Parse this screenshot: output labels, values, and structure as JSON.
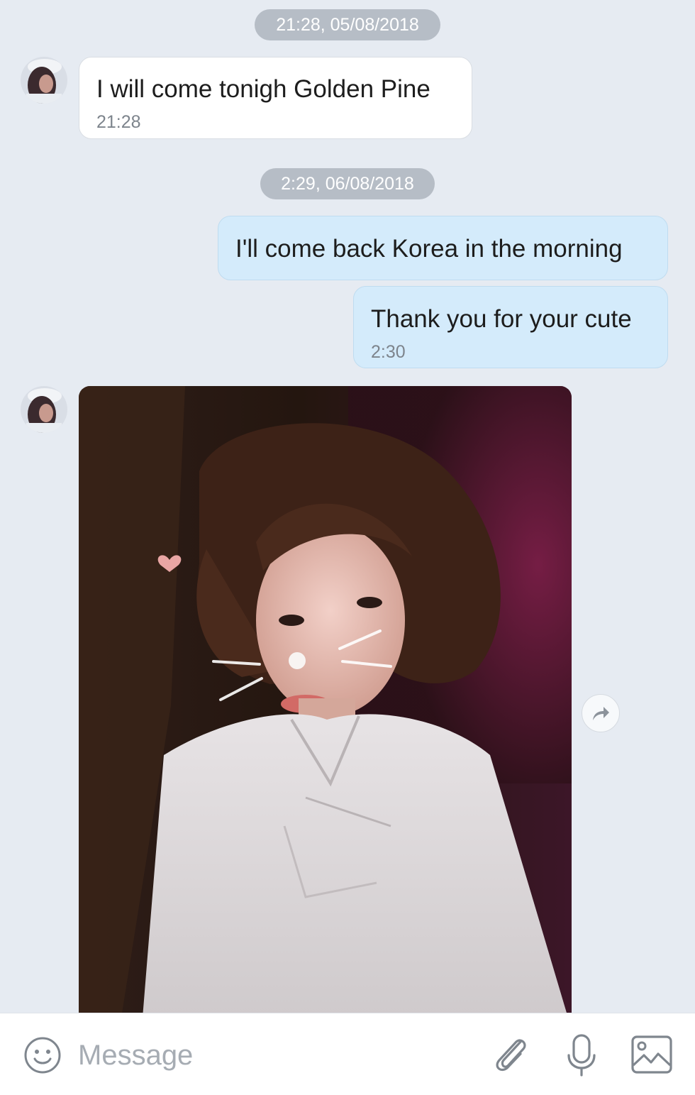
{
  "conversation": {
    "date_separators": [
      "21:28, 05/08/2018",
      "2:29, 06/08/2018"
    ],
    "messages": [
      {
        "direction": "incoming",
        "text": "I will come tonigh Golden Pine",
        "time": "21:28"
      },
      {
        "direction": "outgoing",
        "text": "I'll come back Korea in the morning",
        "time": ""
      },
      {
        "direction": "outgoing",
        "text": "Thank you for your cute",
        "time": "2:30"
      },
      {
        "direction": "incoming",
        "type": "photo",
        "content": "selfie photo"
      }
    ]
  },
  "composer": {
    "placeholder": "Message",
    "icons": [
      "emoji-icon",
      "attach-icon",
      "microphone-icon",
      "image-icon"
    ]
  },
  "share_button": {
    "icon": "share-arrow-icon"
  },
  "colors": {
    "background": "#e6ebf2",
    "incoming_bubble": "#ffffff",
    "outgoing_bubble": "#d4ebfb",
    "date_pill": "#b6bdc6"
  }
}
